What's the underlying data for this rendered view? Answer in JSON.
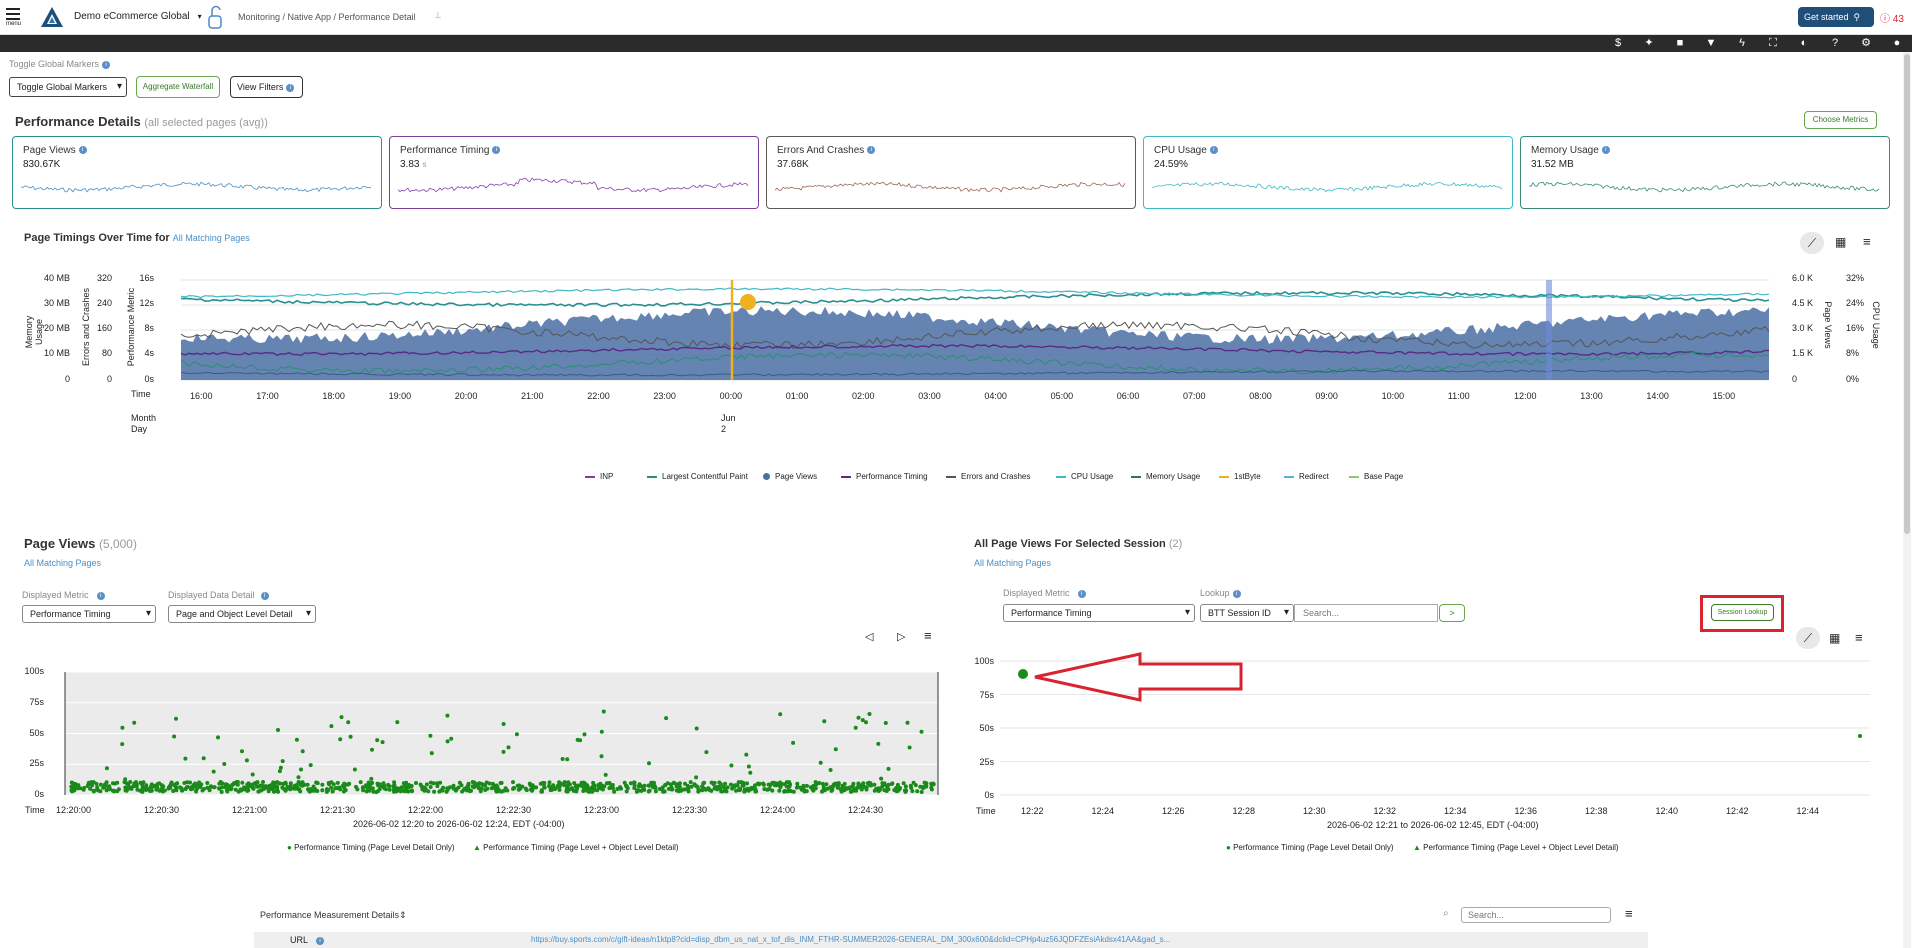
{
  "header": {
    "menu_label": "menu",
    "app_name": "Demo eCommerce Global",
    "breadcrumb": "Monitoring / Native App / Performance Detail",
    "get_started": "Get started",
    "alert_count": "43"
  },
  "controls": {
    "markers_label": "Toggle Global Markers",
    "markers_value": "Toggle Global Markers",
    "aggregate": "Aggregate Waterfall",
    "view_filters": "View Filters"
  },
  "perf": {
    "title": "Performance Details",
    "subtitle": "(all selected pages (avg))",
    "choose": "Choose Metrics"
  },
  "cards": [
    {
      "title": "Page Views",
      "value": "830.67K",
      "color": "#2a8f8f",
      "line": "#4a90c8"
    },
    {
      "title": "Performance Timing",
      "value": "3.83",
      "unit": "s",
      "color": "#7b3f9a",
      "line": "#8a3fb0"
    },
    {
      "title": "Errors And Crashes",
      "value": "37.68K",
      "color": "#5a5a5a",
      "line": "#a0655a"
    },
    {
      "title": "CPU Usage",
      "value": "24.59%",
      "color": "#3fb8c8",
      "line": "#3fb8c8"
    },
    {
      "title": "Memory Usage",
      "value": "31.52 MB",
      "color": "#3a8a7a",
      "line": "#3a8a7a"
    }
  ],
  "timings": {
    "title": "Page Timings Over Time for",
    "link": "All Matching Pages",
    "y_mem": [
      "40 MB",
      "30 MB",
      "20 MB",
      "10 MB",
      "0"
    ],
    "y_err": [
      "320",
      "240",
      "160",
      "80",
      "0"
    ],
    "y_perf": [
      "16s",
      "12s",
      "8s",
      "4s",
      "0s"
    ],
    "y_pv": [
      "6.0 K",
      "4.5 K",
      "3.0 K",
      "1.5 K",
      "0"
    ],
    "y_cpu": [
      "32%",
      "24%",
      "16%",
      "8%",
      "0%"
    ],
    "ax_mem": "Memory Usage",
    "ax_err": "Errors and Crashes",
    "ax_perf": "Performance Metric",
    "ax_pv": "Page Views",
    "ax_cpu": "CPU Usage",
    "time_label": "Time",
    "month_label": "Month",
    "day_label": "Day",
    "month": "Jun",
    "day": "2",
    "x": [
      "16:00",
      "17:00",
      "18:00",
      "19:00",
      "20:00",
      "21:00",
      "22:00",
      "23:00",
      "00:00",
      "01:00",
      "02:00",
      "03:00",
      "04:00",
      "05:00",
      "06:00",
      "07:00",
      "08:00",
      "09:00",
      "10:00",
      "11:00",
      "12:00",
      "13:00",
      "14:00",
      "15:00"
    ],
    "legend": [
      {
        "name": "INP",
        "color": "#7b3f9a"
      },
      {
        "name": "Largest Contentful Paint",
        "color": "#2a8f6f"
      },
      {
        "name": "Page Views",
        "color": "#4a6fa5",
        "dot": true
      },
      {
        "name": "Performance Timing",
        "color": "#5b2a86"
      },
      {
        "name": "Errors and Crashes",
        "color": "#555"
      },
      {
        "name": "CPU Usage",
        "color": "#3fb8c8"
      },
      {
        "name": "Memory Usage",
        "color": "#3a6a6a"
      },
      {
        "name": "1stByte",
        "color": "#f0b020"
      },
      {
        "name": "Redirect",
        "color": "#5ab0d8"
      },
      {
        "name": "Base Page",
        "color": "#8acb6a"
      }
    ]
  },
  "pv": {
    "title": "Page Views",
    "count": "(5,000)",
    "link": "All Matching Pages",
    "metric_label": "Displayed Metric",
    "metric": "Performance Timing",
    "detail_label": "Displayed Data Detail",
    "detail": "Page and Object Level Detail",
    "y": [
      "100s",
      "75s",
      "50s",
      "25s",
      "0s"
    ],
    "time_label": "Time",
    "x": [
      "12:20:00",
      "12:20:30",
      "12:21:00",
      "12:21:30",
      "12:22:00",
      "12:22:30",
      "12:23:00",
      "12:23:30",
      "12:24:00",
      "12:24:30"
    ],
    "range": "2026-06-02 12:20 to 2026-06-02 12:24, EDT (-04:00)",
    "leg1": "Performance Timing (Page Level Detail Only)",
    "leg2": "Performance Timing (Page Level + Object Level Detail)"
  },
  "session": {
    "title": "All Page Views For Selected Session",
    "count": "(2)",
    "link": "All Matching Pages",
    "metric_label": "Displayed Metric",
    "metric": "Performance Timing",
    "lookup_label": "Lookup",
    "lookup": "BTT Session ID",
    "placeholder": "Search...",
    "go": ">",
    "session_lookup": "Session Lookup",
    "y": [
      "100s",
      "75s",
      "50s",
      "25s",
      "0s"
    ],
    "time_label": "Time",
    "x": [
      "12:22",
      "12:24",
      "12:26",
      "12:28",
      "12:30",
      "12:32",
      "12:34",
      "12:36",
      "12:38",
      "12:40",
      "12:42",
      "12:44"
    ],
    "range": "2026-06-02 12:21 to 2026-06-02 12:45, EDT (-04:00)",
    "leg1": "Performance Timing (Page Level Detail Only)",
    "leg2": "Performance Timing (Page Level + Object Level Detail)"
  },
  "pmd": {
    "title": "Performance Measurement Details",
    "search": "Search...",
    "url_label": "URL",
    "url": "https://buy.sports.com/c/gift-ideas/n1ktp8?cid=disp_dbm_us_nat_x_tof_dis_INM_FTHR-SUMMER2026-GENERAL_DM_300x600&dclid=CPHp4uz56JQDFZEsiAkdsx41AA&gad_s..."
  }
}
